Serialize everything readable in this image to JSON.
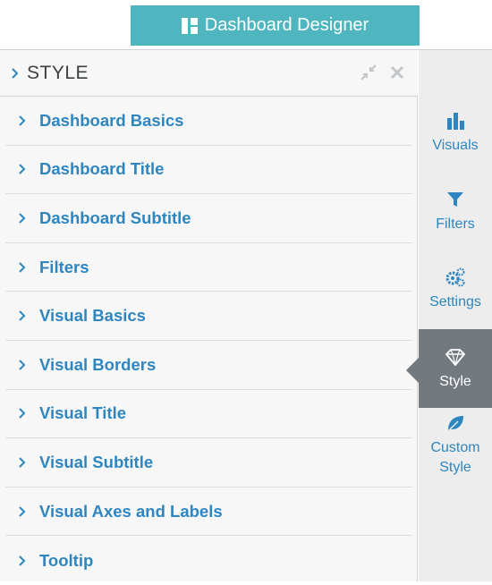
{
  "header": {
    "button_label": "Dashboard Designer"
  },
  "panel": {
    "title": "STYLE",
    "sections": [
      {
        "label": "Dashboard Basics"
      },
      {
        "label": "Dashboard Title"
      },
      {
        "label": "Dashboard Subtitle"
      },
      {
        "label": "Filters"
      },
      {
        "label": "Visual Basics"
      },
      {
        "label": "Visual Borders"
      },
      {
        "label": "Visual Title"
      },
      {
        "label": "Visual Subtitle"
      },
      {
        "label": "Visual Axes and Labels"
      },
      {
        "label": "Tooltip"
      }
    ]
  },
  "sidebar": {
    "items": [
      {
        "label": "Visuals",
        "icon": "bar-chart-icon"
      },
      {
        "label": "Filters",
        "icon": "filter-icon"
      },
      {
        "label": "Settings",
        "icon": "gears-icon"
      },
      {
        "label": "Style",
        "icon": "diamond-icon",
        "active": true
      },
      {
        "label": "Custom Style",
        "icon": "leaf-icon"
      }
    ]
  },
  "colors": {
    "accent": "#2e86c1",
    "header_button": "#4fb6c0",
    "active_tab": "#727a80",
    "panel_bg": "#f7f7f7",
    "sidebar_bg": "#ededed"
  }
}
